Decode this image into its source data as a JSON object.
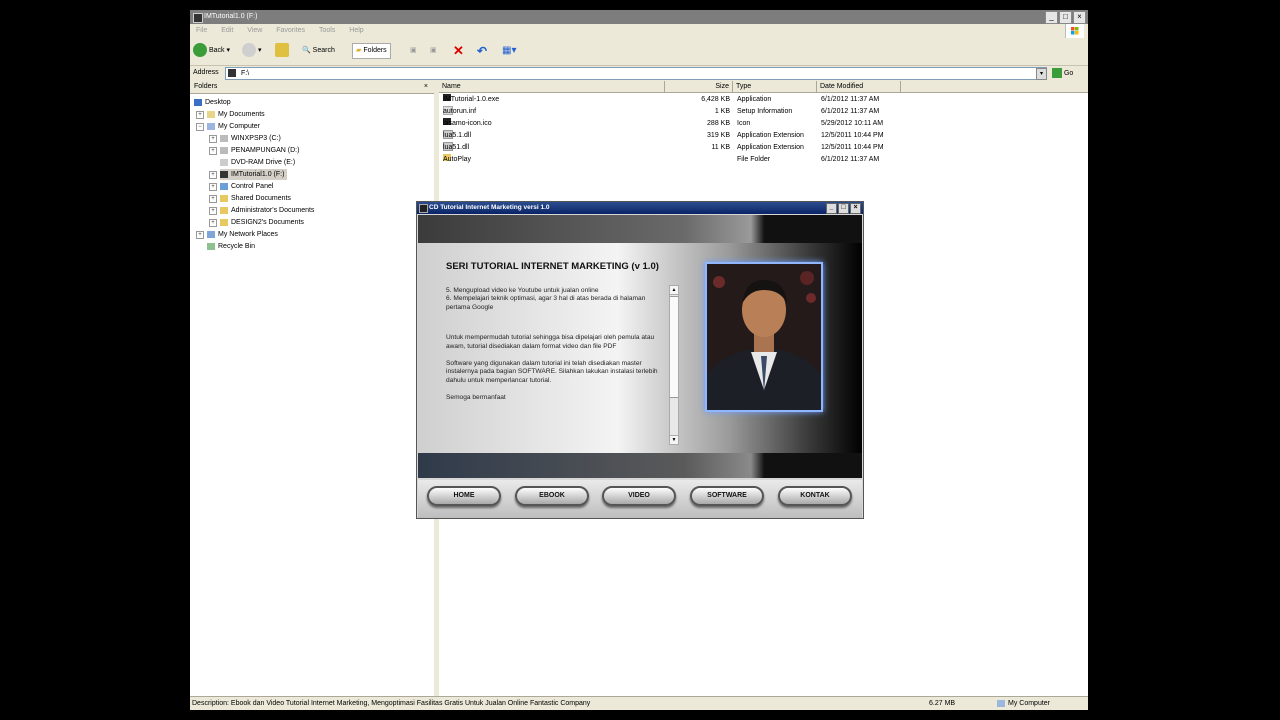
{
  "window": {
    "title": "IMTutorial1.0 (F:)"
  },
  "menu": [
    "File",
    "Edit",
    "View",
    "Favorites",
    "Tools",
    "Help"
  ],
  "toolbar": {
    "back": "Back",
    "search": "Search",
    "folders": "Folders"
  },
  "address": {
    "label": "Address",
    "value": "F:\\",
    "go": "Go"
  },
  "folders_pane": {
    "title": "Folders",
    "items": [
      "Desktop",
      "My Documents",
      "My Computer",
      "WINXPSP3 (C:)",
      "PENAMPUNGAN (D:)",
      "DVD-RAM Drive (E:)",
      "IMTutorial1.0 (F:)",
      "Control Panel",
      "Shared Documents",
      "Administrator's Documents",
      "DESIGN2's Documents",
      "My Network Places",
      "Recycle Bin"
    ]
  },
  "file_list": {
    "columns": [
      "Name",
      "Size",
      "Type",
      "Date Modified"
    ],
    "rows": [
      {
        "name": "IMTutorial-1.0.exe",
        "size": "6,428 KB",
        "type": "Application",
        "date": "6/1/2012 11:37 AM"
      },
      {
        "name": "autorun.inf",
        "size": "1 KB",
        "type": "Setup Information",
        "date": "6/1/2012 11:37 AM"
      },
      {
        "name": "bisamo-icon.ico",
        "size": "288 KB",
        "type": "Icon",
        "date": "5/29/2012 10:11 AM"
      },
      {
        "name": "lua5.1.dll",
        "size": "319 KB",
        "type": "Application Extension",
        "date": "12/5/2011 10:44 PM"
      },
      {
        "name": "lua51.dll",
        "size": "11 KB",
        "type": "Application Extension",
        "date": "12/5/2011 10:44 PM"
      },
      {
        "name": "AutoPlay",
        "size": "",
        "type": "File Folder",
        "date": "6/1/2012 11:37 AM"
      }
    ]
  },
  "status": {
    "description": "Description: Ebook dan Video Tutorial Internet Marketing, Mengoptimasi Fasilitas Gratis Untuk Jualan Online Fantastic Company",
    "size": "6.27 MB",
    "computer": "My Computer"
  },
  "dialog": {
    "title": "CD Tutorial Internet Marketing versi 1.0",
    "heading": "SERI TUTORIAL INTERNET MARKETING (v 1.0)",
    "paragraphs": [
      "5. Mengupload video ke Youtube untuk jualan online\n6. Mempelajari teknik optimasi, agar 3 hal di atas berada di halaman pertama Google",
      "Untuk mempermudah tutorial sehingga bisa dipelajari oleh pemula atau awam, tutorial disediakan dalam format video dan file PDF",
      "Software yang digunakan dalam tutorial ini telah disediakan master instalernya pada bagian SOFTWARE. Silahkan lakukan instalasi terlebih dahulu untuk memperlancar tutorial.",
      "Semoga bermanfaat"
    ],
    "buttons": [
      "HOME",
      "EBOOK",
      "VIDEO",
      "SOFTWARE",
      "KONTAK"
    ]
  }
}
